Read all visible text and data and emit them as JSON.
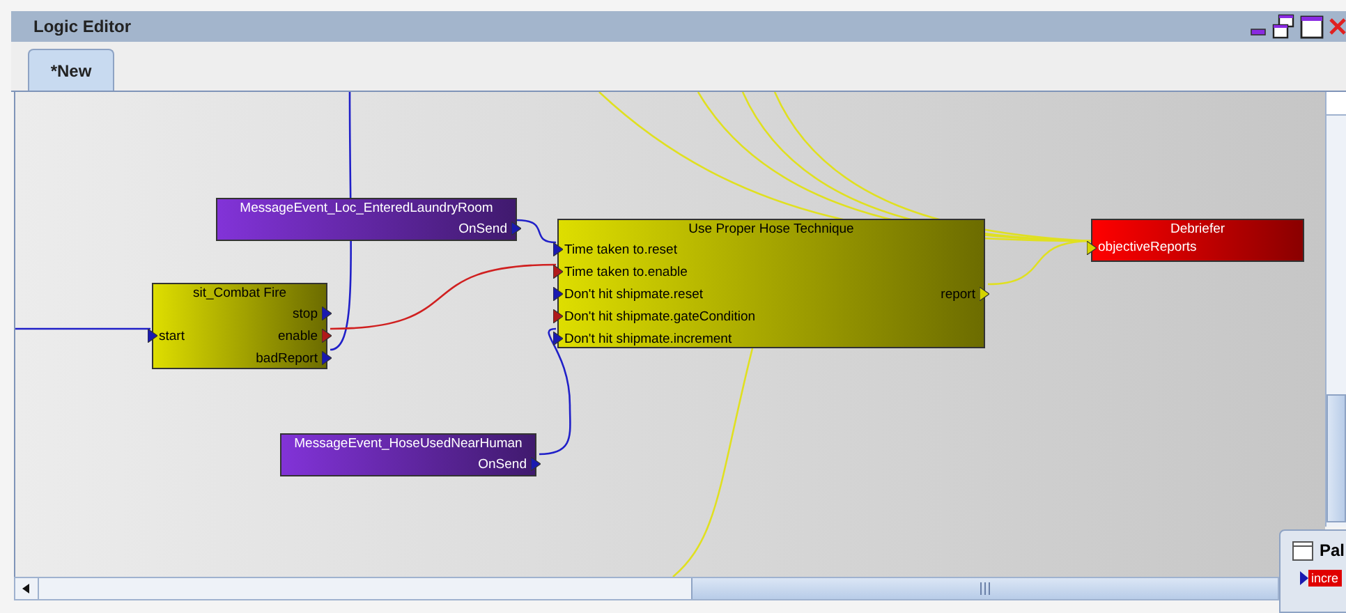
{
  "window": {
    "title": "Logic Editor"
  },
  "tabs": [
    {
      "label": "*New",
      "selected": true
    }
  ],
  "nodes": [
    {
      "kind": "message",
      "title": "MessageEvent_Loc_EnteredLaundryRoom",
      "outputs": [
        {
          "label": "OnSend",
          "color": "#1a1ab0"
        }
      ]
    },
    {
      "kind": "situation",
      "title": "sit_Combat Fire",
      "inputs": [
        {
          "label": "start",
          "color": "#1a1ab0"
        }
      ],
      "outputs": [
        {
          "label": "stop",
          "color": "#1a1ab0"
        },
        {
          "label": "enable",
          "color": "#b01a1a"
        },
        {
          "label": "badReport",
          "color": "#1a1ab0"
        }
      ]
    },
    {
      "kind": "situation",
      "title": "Use Proper Hose Technique",
      "inputs": [
        {
          "label": "Time taken to.reset",
          "color": "#1a1ab0"
        },
        {
          "label": "Time taken to.enable",
          "color": "#b01a1a"
        },
        {
          "label": "Don't hit shipmate.reset",
          "color": "#1a1ab0"
        },
        {
          "label": "Don't hit shipmate.gateCondition",
          "color": "#b01a1a"
        },
        {
          "label": "Don't hit shipmate.increment",
          "color": "#1a1ab0"
        }
      ],
      "outputs": [
        {
          "label": "report",
          "color": "#d4d400"
        }
      ]
    },
    {
      "kind": "debrief",
      "title": "Debriefer",
      "inputs": [
        {
          "label": "objectiveReports",
          "color": "#d4d400"
        }
      ]
    },
    {
      "kind": "message",
      "title": "MessageEvent_HoseUsedNearHuman",
      "outputs": [
        {
          "label": "OnSend",
          "color": "#1a1ab0"
        }
      ]
    }
  ],
  "palette": {
    "title": "Pal",
    "item": "incre"
  }
}
